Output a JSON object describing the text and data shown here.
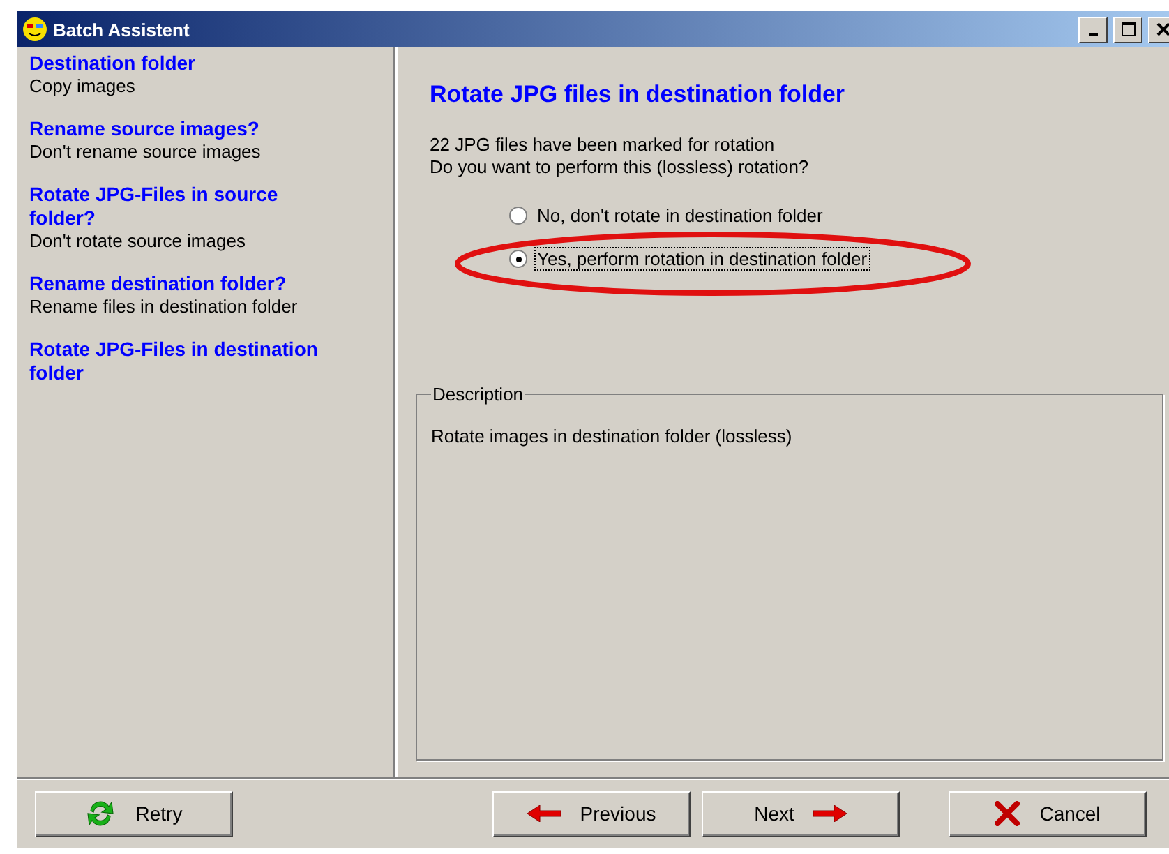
{
  "window": {
    "title": "Batch Assistent"
  },
  "steps": [
    {
      "title": "Destination folder",
      "subtitle": "Copy images"
    },
    {
      "title": "Rename source images?",
      "subtitle": "Don't rename source images"
    },
    {
      "title": "Rotate JPG-Files in source folder?",
      "subtitle": "Don't rotate source images"
    },
    {
      "title": "Rename destination folder?",
      "subtitle": "Rename files in destination folder"
    },
    {
      "title": "Rotate JPG-Files in destination folder"
    }
  ],
  "page": {
    "heading": "Rotate JPG files in destination folder",
    "lines": [
      "22 JPG files have been marked for rotation",
      "Do you want to perform this (lossless) rotation?"
    ],
    "options": [
      {
        "label": "No, don't rotate in destination folder",
        "selected": false
      },
      {
        "label": "Yes, perform rotation in destination folder",
        "selected": true
      }
    ],
    "description": {
      "legend": "Description",
      "text": "Rotate images in destination folder (lossless)"
    }
  },
  "buttons": [
    {
      "kind": "retry",
      "label": "Retry"
    },
    {
      "kind": "previous",
      "label": "Previous"
    },
    {
      "kind": "next",
      "label": "Next"
    },
    {
      "kind": "cancel",
      "label": "Cancel"
    }
  ]
}
